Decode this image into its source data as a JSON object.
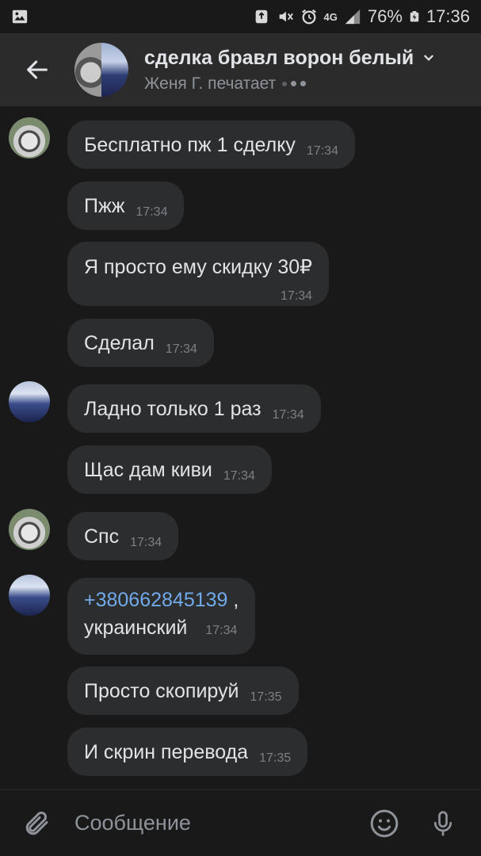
{
  "statusbar": {
    "battery": "76%",
    "time": "17:36",
    "network": "4G"
  },
  "header": {
    "title": "сделка бравл ворон белый",
    "subtitle": "Женя Г. печатает"
  },
  "messages": [
    {
      "text": "Бесплатно пж 1 сделку",
      "time": "17:34"
    },
    {
      "text": "Пжж",
      "time": "17:34"
    },
    {
      "text": "Я просто ему скидку 30₽",
      "time": "17:34"
    },
    {
      "text": "Сделал",
      "time": "17:34"
    },
    {
      "text": "Ладно только 1 раз",
      "time": "17:34"
    },
    {
      "text": "Щас дам киви",
      "time": "17:34"
    },
    {
      "text": "Спс",
      "time": "17:34"
    },
    {
      "link": "+380662845139",
      "after_link": " ,",
      "text": "украинский",
      "time": "17:34"
    },
    {
      "text": "Просто скопируй",
      "time": "17:35"
    },
    {
      "text": "И скрин перевода",
      "time": "17:35"
    }
  ],
  "composer": {
    "placeholder": "Сообщение"
  },
  "colors": {
    "background": "#19191a",
    "bubble": "#2c2d2e",
    "header": "#2b2b2c",
    "link": "#71aaeb"
  }
}
